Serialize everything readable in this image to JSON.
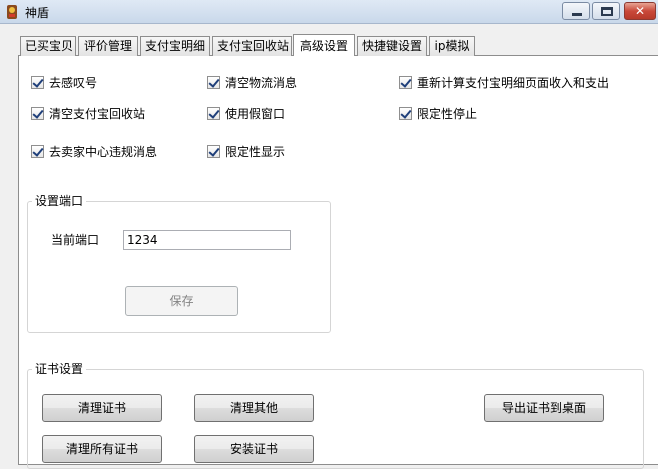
{
  "window": {
    "title": "神盾"
  },
  "tabs": [
    {
      "label": "已买宝贝"
    },
    {
      "label": "评价管理"
    },
    {
      "label": "支付宝明细"
    },
    {
      "label": "支付宝回收站"
    },
    {
      "label": "高级设置",
      "active": true
    },
    {
      "label": "快捷键设置"
    },
    {
      "label": "ip模拟"
    }
  ],
  "options": [
    {
      "label": "去感叹号",
      "checked": true
    },
    {
      "label": "清空物流消息",
      "checked": true
    },
    {
      "label": "重新计算支付宝明细页面收入和支出",
      "checked": true
    },
    {
      "label": "清空支付宝回收站",
      "checked": true
    },
    {
      "label": "使用假窗口",
      "checked": true
    },
    {
      "label": "限定性停止",
      "checked": true
    },
    {
      "label": "去卖家中心违规消息",
      "checked": true
    },
    {
      "label": "限定性显示",
      "checked": true
    }
  ],
  "port_group": {
    "title": "设置端口",
    "current_port_label": "当前端口",
    "current_port_value": "1234",
    "save_label": "保存"
  },
  "cert_group": {
    "title": "证书设置",
    "buttons": {
      "clear_cert": "清理证书",
      "clear_other": "清理其他",
      "export_cert": "导出证书到桌面",
      "clear_all_cert": "清理所有证书",
      "install_cert": "安装证书"
    }
  },
  "colors": {
    "titlebar": "#c9d8ea",
    "close": "#c9493a",
    "panel": "#ffffff"
  }
}
